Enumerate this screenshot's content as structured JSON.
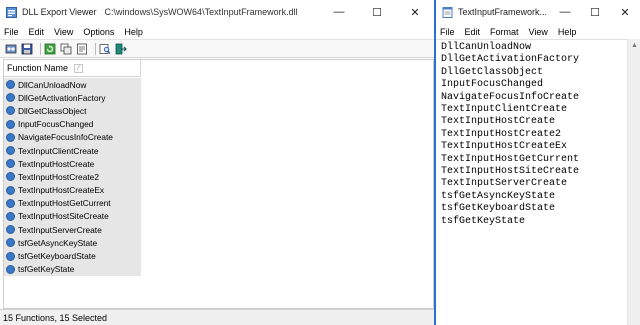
{
  "left_window": {
    "title": "DLL Export Viewer",
    "path": "C:\\windows\\SysWOW64\\TextInputFramework.dll",
    "caption_buttons": {
      "minimize": "—",
      "maximize": "☐",
      "close": "✕"
    },
    "menu": [
      "File",
      "Edit",
      "View",
      "Options",
      "Help"
    ],
    "toolbar_icons": [
      "open-icon",
      "save-icon",
      "refresh-icon",
      "copy-icon",
      "properties-icon",
      "find-icon",
      "exit-icon"
    ],
    "list": {
      "header": "Function Name",
      "rows": [
        "DllCanUnloadNow",
        "DllGetActivationFactory",
        "DllGetClassObject",
        "InputFocusChanged",
        "NavigateFocusInfoCreate",
        "TextInputClientCreate",
        "TextInputHostCreate",
        "TextInputHostCreate2",
        "TextInputHostCreateEx",
        "TextInputHostGetCurrent",
        "TextInputHostSiteCreate",
        "TextInputServerCreate",
        "tsfGetAsyncKeyState",
        "tsfGetKeyboardState",
        "tsfGetKeyState"
      ]
    },
    "status": "15 Functions, 15 Selected"
  },
  "right_window": {
    "title": "TextInputFramework...",
    "caption_buttons": {
      "minimize": "—",
      "maximize": "☐",
      "close": "✕"
    },
    "menu": [
      "File",
      "Edit",
      "Format",
      "View",
      "Help"
    ],
    "lines": [
      "DllCanUnloadNow",
      "DllGetActivationFactory",
      "DllGetClassObject",
      "InputFocusChanged",
      "NavigateFocusInfoCreate",
      "TextInputClientCreate",
      "TextInputHostCreate",
      "TextInputHostCreate2",
      "TextInputHostCreateEx",
      "TextInputHostGetCurrent",
      "TextInputHostSiteCreate",
      "TextInputServerCreate",
      "tsfGetAsyncKeyState",
      "tsfGetKeyboardState",
      "tsfGetKeyState"
    ]
  },
  "colors": {
    "accent": "#2a6fd4",
    "row_icon": "#3a78c8",
    "row_bg": "#e6e6e6"
  }
}
